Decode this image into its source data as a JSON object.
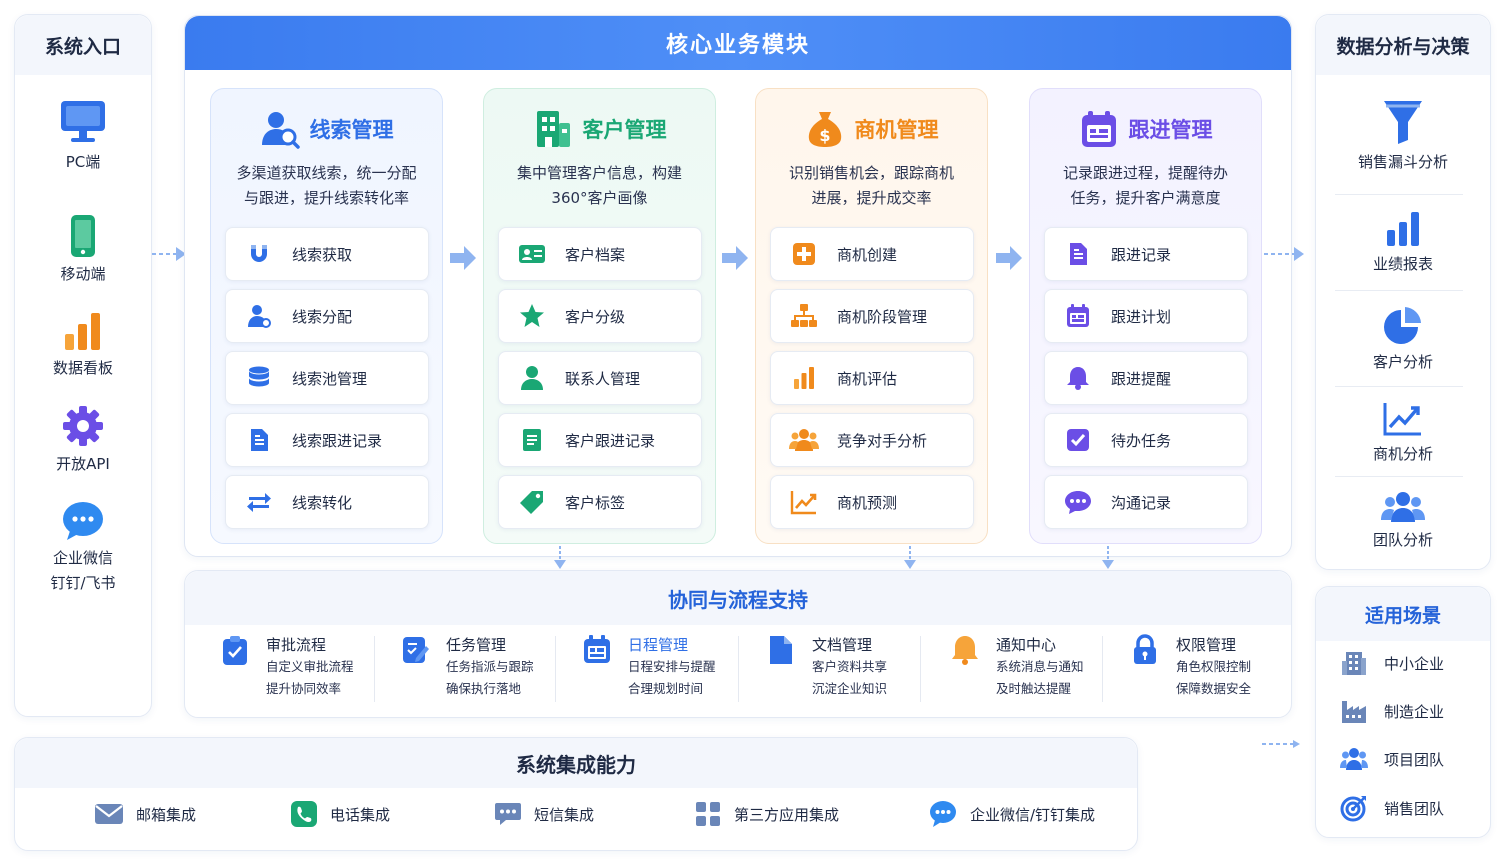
{
  "entry": {
    "title": "系统入口",
    "items": [
      {
        "label": "PC端",
        "icon": "monitor-icon"
      },
      {
        "label": "移动端",
        "icon": "mobile-icon"
      },
      {
        "label": "数据看板",
        "icon": "bar-chart-icon"
      },
      {
        "label": "开放API",
        "icon": "gear-icon"
      },
      {
        "label": "企业微信",
        "label2": "钉钉/飞书",
        "icon": "chat-icon"
      }
    ]
  },
  "core": {
    "title": "核心业务模块",
    "modules": [
      {
        "title": "线索管理",
        "color": "#2f6fe6",
        "desc1": "多渠道获取线索，统一分配",
        "desc2": "与跟进，提升线索转化率",
        "items": [
          "线索获取",
          "线索分配",
          "线索池管理",
          "线索跟进记录",
          "线索转化"
        ]
      },
      {
        "title": "客户管理",
        "color": "#1aa774",
        "desc1": "集中管理客户信息，构建",
        "desc2": "360°客户画像",
        "items": [
          "客户档案",
          "客户分级",
          "联系人管理",
          "客户跟进记录",
          "客户标签"
        ]
      },
      {
        "title": "商机管理",
        "color": "#f08a1c",
        "desc1": "识别销售机会，跟踪商机",
        "desc2": "进展，提升成交率",
        "items": [
          "商机创建",
          "商机阶段管理",
          "商机评估",
          "竞争对手分析",
          "商机预测"
        ]
      },
      {
        "title": "跟进管理",
        "color": "#6b4ee6",
        "desc1": "记录跟进过程，提醒待办",
        "desc2": "任务，提升客户满意度",
        "items": [
          "跟进记录",
          "跟进计划",
          "跟进提醒",
          "待办任务",
          "沟通记录"
        ]
      }
    ]
  },
  "collab": {
    "title": "协同与流程支持",
    "items": [
      {
        "title": "审批流程",
        "d1": "自定义审批流程",
        "d2": "提升协同效率"
      },
      {
        "title": "任务管理",
        "d1": "任务指派与跟踪",
        "d2": "确保执行落地"
      },
      {
        "title": "日程管理",
        "d1": "日程安排与提醒",
        "d2": "合理规划时间"
      },
      {
        "title": "文档管理",
        "d1": "客户资料共享",
        "d2": "沉淀企业知识"
      },
      {
        "title": "通知中心",
        "d1": "系统消息与通知",
        "d2": "及时触达提醒"
      },
      {
        "title": "权限管理",
        "d1": "角色权限控制",
        "d2": "保障数据安全"
      }
    ]
  },
  "integration": {
    "title": "系统集成能力",
    "items": [
      "邮箱集成",
      "电话集成",
      "短信集成",
      "第三方应用集成",
      "企业微信/钉钉集成"
    ]
  },
  "analysis": {
    "title": "数据分析与决策",
    "items": [
      "销售漏斗分析",
      "业绩报表",
      "客户分析",
      "商机分析",
      "团队分析"
    ]
  },
  "scenes": {
    "title": "适用场景",
    "items": [
      "中小企业",
      "制造企业",
      "项目团队",
      "销售团队"
    ]
  },
  "colors": {
    "accent": "#2f6fe6",
    "green": "#1aa774",
    "orange": "#f08a1c",
    "purple": "#6b4ee6"
  }
}
